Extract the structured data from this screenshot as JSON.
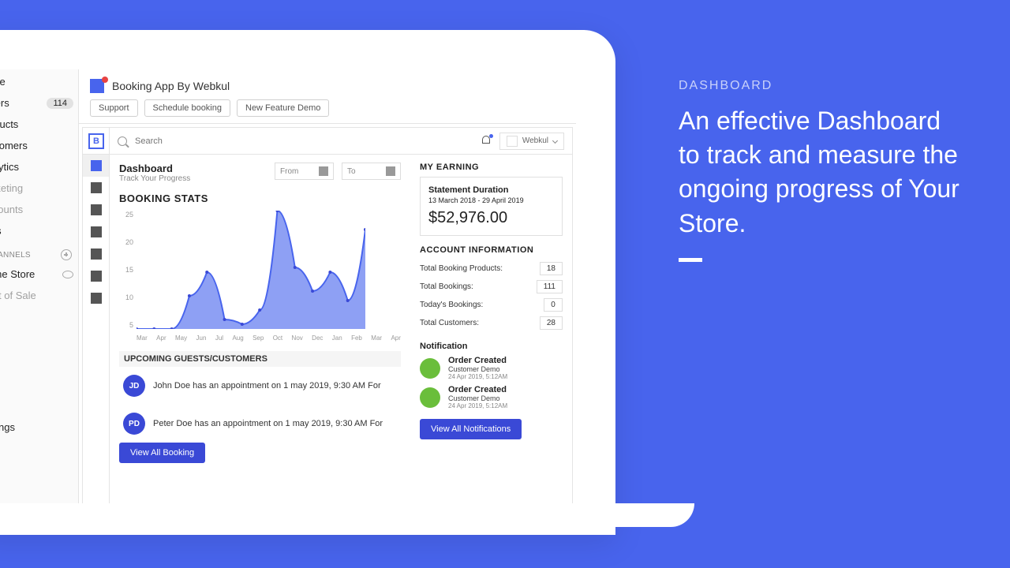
{
  "shopify_nav": {
    "home": "Home",
    "orders": "Orders",
    "orders_badge": "114",
    "products": "Products",
    "customers": "Customers",
    "analytics": "Analytics",
    "marketing": "Marketing",
    "discounts": "Discounts",
    "apps": "Apps",
    "channels_label": "S CHANNELS",
    "online_store": "Online Store",
    "point_of_sale": "Point of Sale",
    "settings": "Settings"
  },
  "app": {
    "title": "Booking App By Webkul",
    "btn_support": "Support",
    "btn_schedule": "Schedule booking",
    "btn_demo": "New Feature Demo"
  },
  "search": {
    "placeholder": "Search"
  },
  "user": {
    "name": "Webkul"
  },
  "dashboard": {
    "title": "Dashboard",
    "subtitle": "Track Your Progress",
    "date_from": "From",
    "date_to": "To"
  },
  "booking_stats": {
    "title": "BOOKING STATS"
  },
  "chart_data": {
    "type": "area",
    "categories": [
      "Mar",
      "Apr",
      "May",
      "Jun",
      "Jul",
      "Aug",
      "Sep",
      "Oct",
      "Nov",
      "Dec",
      "Jan",
      "Feb",
      "Mar",
      "Apr"
    ],
    "values": [
      0,
      0,
      0,
      7,
      12,
      2,
      1,
      4,
      25,
      13,
      8,
      12,
      6,
      21
    ],
    "ylim": [
      0,
      25
    ],
    "yticks": [
      25,
      20,
      15,
      10,
      5
    ],
    "title": "BOOKING STATS",
    "xlabel": "",
    "ylabel": ""
  },
  "guests": {
    "title": "UPCOMING GUESTS/CUSTOMERS",
    "items": [
      {
        "initials": "JD",
        "text": "John Doe has an appointment on 1 may 2019, 9:30 AM For"
      },
      {
        "initials": "PD",
        "text": "Peter Doe has an appointment on 1 may 2019, 9:30 AM For"
      }
    ],
    "view_all": "View All Booking"
  },
  "earning": {
    "title": "MY EARNING",
    "statement_label": "Statement Duration",
    "statement_dates": "13 March 2018 - 29 April 2019",
    "amount": "$52,976.00"
  },
  "account": {
    "title": "ACCOUNT INFORMATION",
    "rows": [
      {
        "label": "Total Booking Products:",
        "value": "18"
      },
      {
        "label": "Total Bookings:",
        "value": "111"
      },
      {
        "label": "Today's Bookings:",
        "value": "0"
      },
      {
        "label": "Total Customers:",
        "value": "28"
      }
    ]
  },
  "notifications": {
    "title": "Notification",
    "items": [
      {
        "title": "Order Created",
        "sub": "Customer Demo",
        "date": "24 Apr 2019, 5:12AM"
      },
      {
        "title": "Order Created",
        "sub": "Customer Demo",
        "date": "24 Apr 2019, 5:12AM"
      }
    ],
    "view_all": "View All Notifications"
  },
  "promo": {
    "eyebrow": "DASHBOARD",
    "title": "An effective Dashboard to track and measure the ongoing progress of Your Store."
  }
}
